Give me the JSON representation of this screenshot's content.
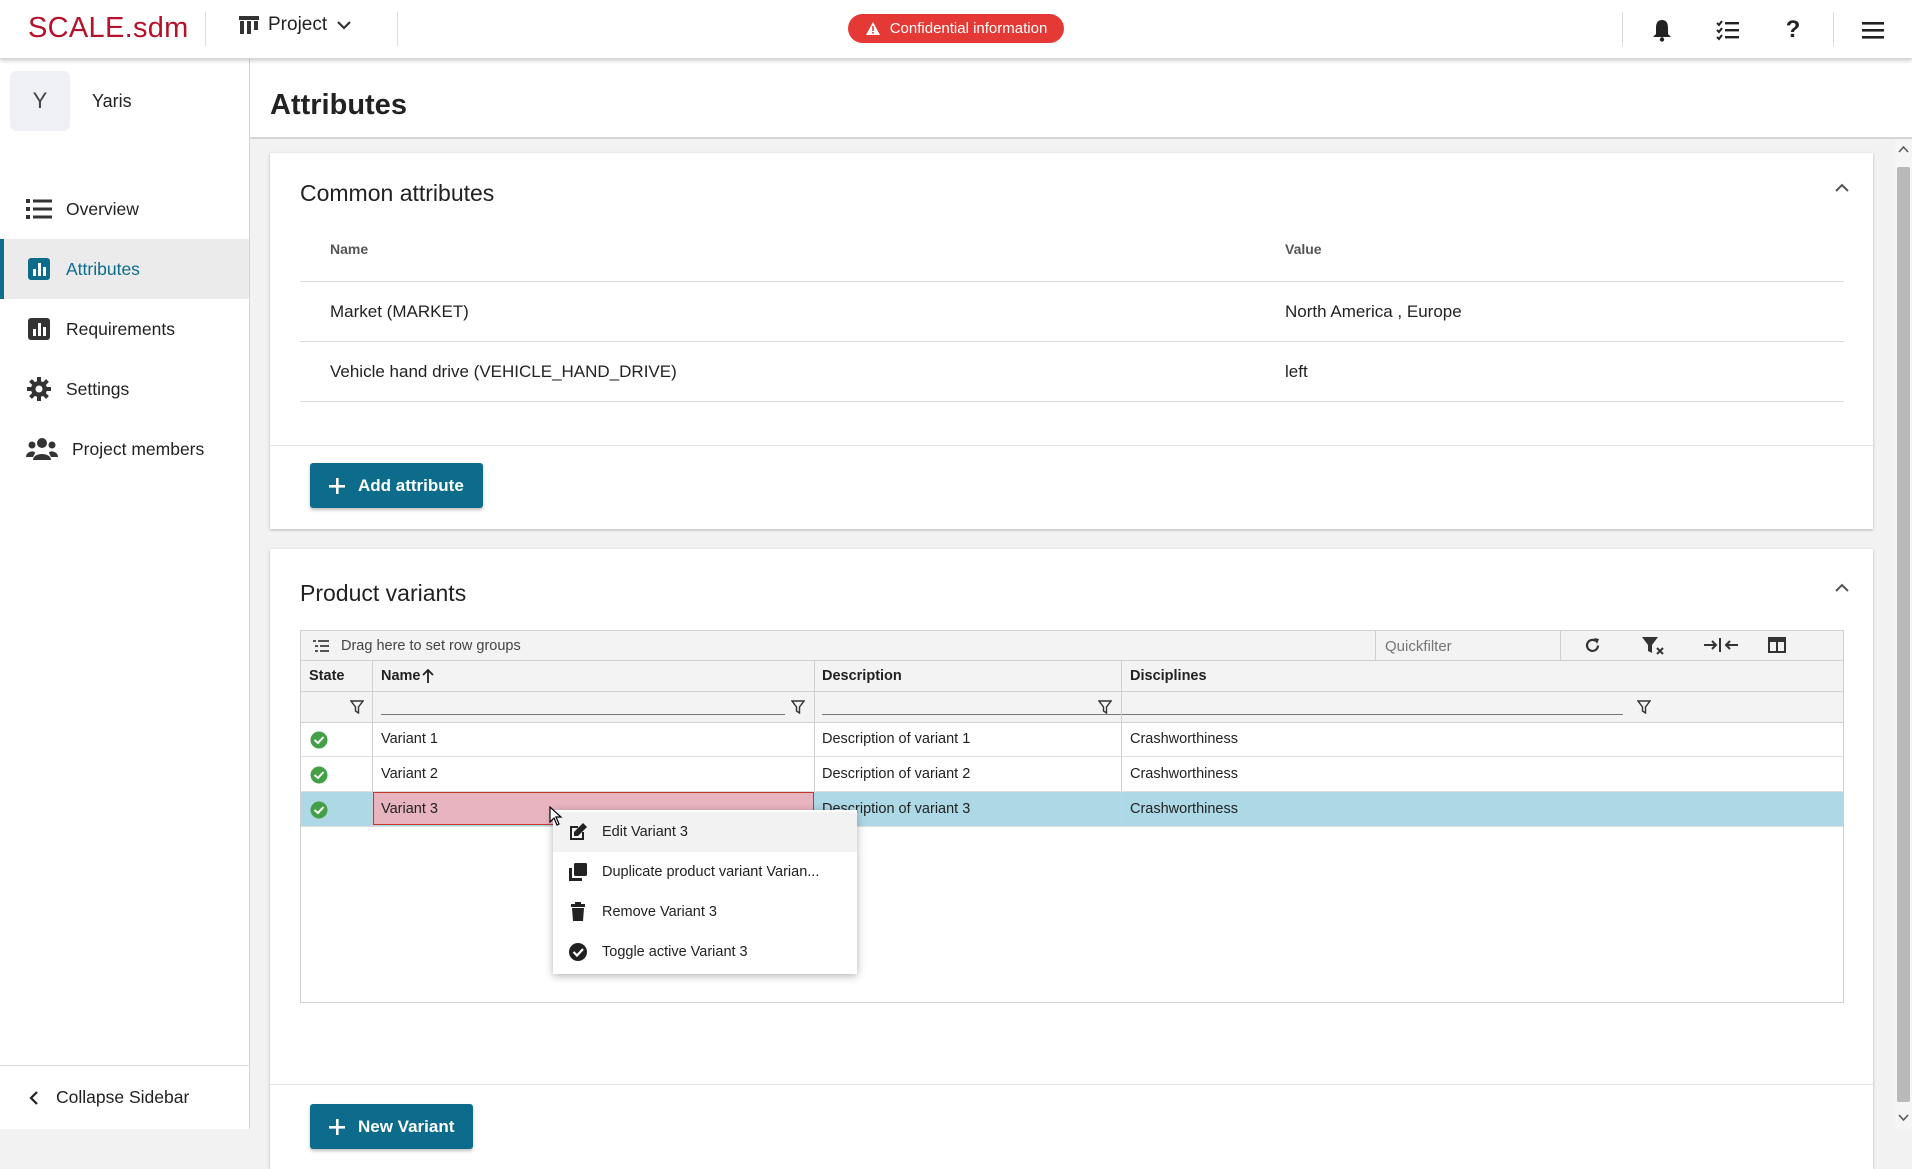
{
  "topbar": {
    "logo": "SCALE.sdm",
    "project_menu_label": "Project",
    "confidential_label": "Confidential information"
  },
  "sidebar": {
    "avatar_letter": "Y",
    "project_name": "Yaris",
    "items": [
      {
        "label": "Overview",
        "icon": "list-icon"
      },
      {
        "label": "Attributes",
        "icon": "chart-icon",
        "active": true
      },
      {
        "label": "Requirements",
        "icon": "chart-icon"
      },
      {
        "label": "Settings",
        "icon": "gear-icon"
      },
      {
        "label": "Project members",
        "icon": "users-icon"
      }
    ],
    "collapse_label": "Collapse Sidebar"
  },
  "page": {
    "title": "Attributes"
  },
  "common_attributes": {
    "title": "Common attributes",
    "headers": {
      "name": "Name",
      "value": "Value"
    },
    "rows": [
      {
        "name": "Market (MARKET)",
        "value": "North America , Europe"
      },
      {
        "name": "Vehicle hand drive (VEHICLE_HAND_DRIVE)",
        "value": "left"
      }
    ],
    "add_button": "Add attribute"
  },
  "product_variants": {
    "title": "Product variants",
    "group_hint": "Drag here to set row groups",
    "quickfilter_placeholder": "Quickfilter",
    "columns": {
      "state": "State",
      "name": "Name",
      "description": "Description",
      "disciplines": "Disciplines"
    },
    "sort": {
      "column": "Name",
      "direction": "ascending"
    },
    "rows": [
      {
        "state": "active",
        "name": "Variant 1",
        "description": "Description of variant 1",
        "disciplines": "Crashworthiness"
      },
      {
        "state": "active",
        "name": "Variant 2",
        "description": "Description of variant 2",
        "disciplines": "Crashworthiness"
      },
      {
        "state": "active",
        "name": "Variant 3",
        "description": "Description of variant 3",
        "disciplines": "Crashworthiness",
        "selected": true
      }
    ],
    "context_menu": [
      {
        "label": "Edit Variant 3",
        "icon": "edit-icon"
      },
      {
        "label": "Duplicate product variant Varian...",
        "icon": "duplicate-icon"
      },
      {
        "label": "Remove Variant 3",
        "icon": "trash-icon"
      },
      {
        "label": "Toggle active Variant 3",
        "icon": "check-circle-icon"
      }
    ],
    "new_button": "New Variant"
  },
  "colors": {
    "brand": "#b5122b",
    "accent": "#0d6c8c",
    "danger": "#e53935",
    "selected_row": "#add8e6",
    "selected_cell": "#e8b4c0",
    "status_ok": "#43a047"
  }
}
